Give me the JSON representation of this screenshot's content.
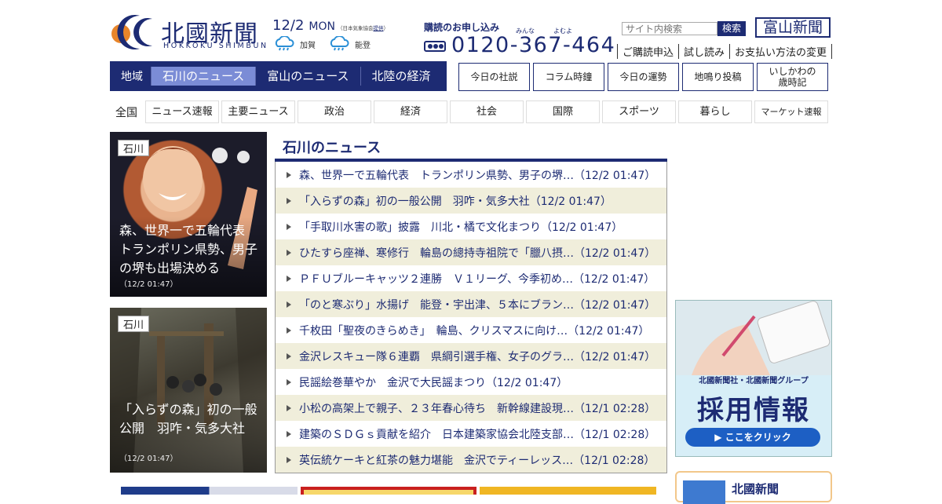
{
  "header": {
    "logo_jp": "北國新聞",
    "logo_en": "HOKKOKU SHIMBUN",
    "date": "12/2",
    "weekday": "MON",
    "weather_credit_prefix": "（日本気象協会",
    "weather_credit_link": "提供",
    "weather_credit_suffix": "）",
    "weather": [
      {
        "label": "加賀",
        "icon": "rain-cloud-icon"
      },
      {
        "label": "能登",
        "icon": "rain-cloud-icon"
      }
    ],
    "subscribe_title": "購読のお申し込み",
    "subscribe_ruby": "みんな　　　よむよ",
    "phone": "0120-367-464",
    "search_placeholder": "サイト内検索",
    "search_button": "検索",
    "toyama_logo": "富山新聞",
    "links": [
      "ご購読申込",
      "試し読み",
      "お支払い方法の変更"
    ]
  },
  "region_nav": {
    "label": "地域",
    "tabs": [
      "石川のニュース",
      "富山のニュース",
      "北陸の経済"
    ],
    "active_index": 0
  },
  "column_nav": [
    "今日の社説",
    "コラム時鐘",
    "今日の運勢",
    "地鳴り投稿",
    "いしかわの\n歳時記"
  ],
  "category_nav": {
    "label": "全国",
    "items": [
      "ニュース速報",
      "主要ニュース",
      "政治",
      "経済",
      "社会",
      "国際",
      "スポーツ",
      "暮らし",
      "マーケット速報"
    ]
  },
  "photos": [
    {
      "tag": "石川",
      "caption": "森、世界一で五輪代表　トランポリン県勢、男子の堺も出場決める",
      "time": "（12/2 01:47）"
    },
    {
      "tag": "石川",
      "caption": "「入らずの森」初の一般公開　羽咋・気多大社",
      "time": "（12/2 01:47）"
    }
  ],
  "news": {
    "title": "石川のニュース",
    "items": [
      "森、世界一で五輪代表　トランポリン県勢、男子の堺…（12/2 01:47）",
      "「入らずの森」初の一般公開　羽咋・気多大社（12/2 01:47）",
      "「手取川水害の歌」披露　川北・橘で文化まつり（12/2 01:47）",
      "ひたすら座禅、寒修行　輪島の總持寺祖院で「臘八摂…（12/2 01:47）",
      "ＰＦＵブルーキャッツ２連勝　Ｖ１リーグ、今季初め…（12/2 01:47）",
      "「のと寒ぶり」水揚げ　能登・宇出津、５本にブラン…（12/2 01:47）",
      "千枚田「聖夜のきらめき」　輪島、クリスマスに向け…（12/2 01:47）",
      "金沢レスキュー隊６連覇　県綱引選手権、女子のグラ…（12/2 01:47）",
      "民謡絵巻華やか　金沢で大民謡まつり（12/2 01:47）",
      "小松の高架上で親子、２３年春心待ち　新幹線建設現…（12/1 02:28）",
      "建築のＳＤＧｓ貢献を紹介　日本建築家協会北陸支部…（12/1 02:28）",
      "英伝統ケーキと紅茶の魅力堪能　金沢でティーレッス…（12/1 02:28）"
    ]
  },
  "banner": {
    "line1": "北國新聞社・北國新聞グループ",
    "line2": "採用情報",
    "cta": "▶ ここをクリック"
  },
  "card2": {
    "title": "北國新聞"
  },
  "colors": {
    "brand": "#1d2b73",
    "active_tab": "#7b8cd6",
    "row_alt": "#f0eedb"
  }
}
